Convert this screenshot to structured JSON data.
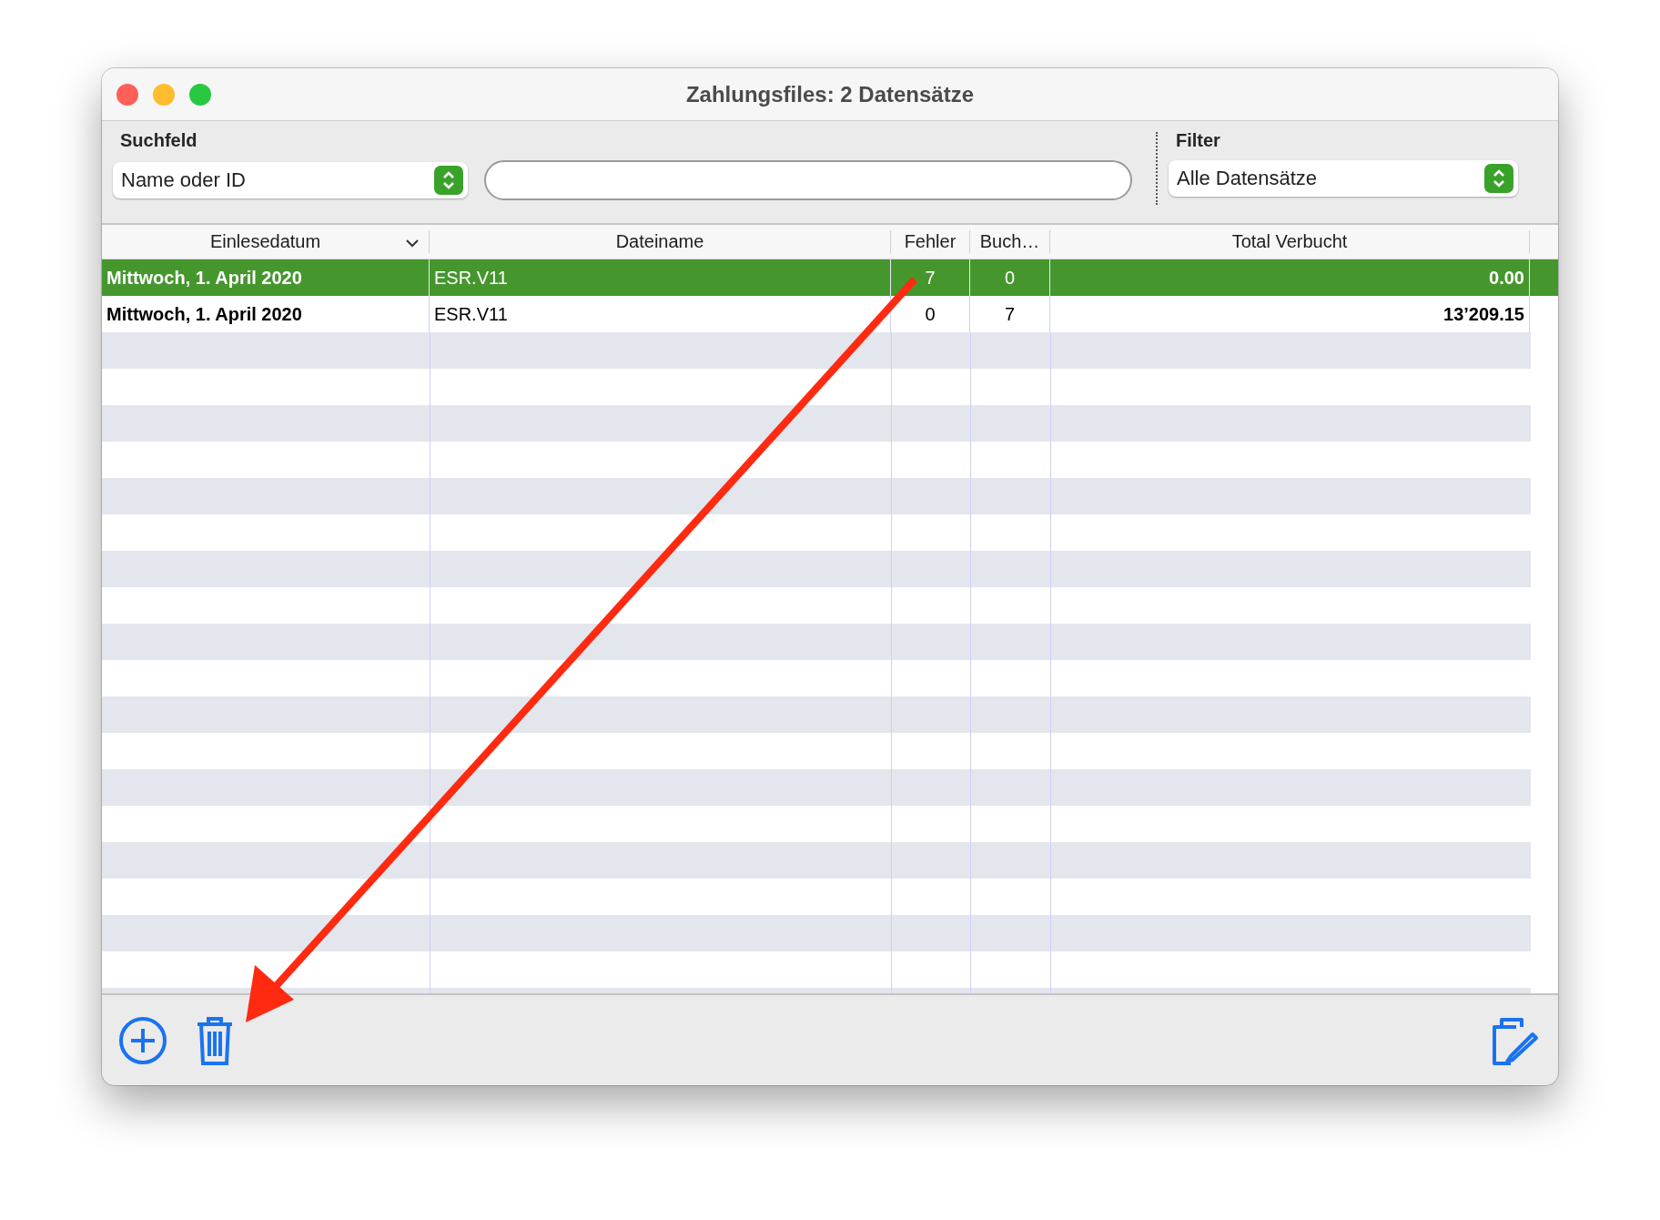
{
  "window": {
    "title": "Zahlungsfiles: 2 Datensätze"
  },
  "search": {
    "label": "Suchfeld",
    "field_popup": "Name oder ID"
  },
  "filter": {
    "label": "Filter",
    "popup": "Alle Datensätze"
  },
  "table": {
    "columns": [
      {
        "label": "Einlesedatum",
        "sorted": true
      },
      {
        "label": "Dateiname",
        "sorted": false
      },
      {
        "label": "Fehler",
        "sorted": false
      },
      {
        "label": "Buch…",
        "sorted": false
      },
      {
        "label": "Total Verbucht",
        "sorted": false
      }
    ],
    "rows": [
      {
        "selected": true,
        "cells": [
          "Mittwoch, 1. April 2020",
          "ESR.V11",
          "7",
          "0",
          "0.00"
        ]
      },
      {
        "selected": false,
        "cells": [
          "Mittwoch, 1. April 2020",
          "ESR.V11",
          "0",
          "7",
          "13’209.15"
        ]
      }
    ]
  }
}
